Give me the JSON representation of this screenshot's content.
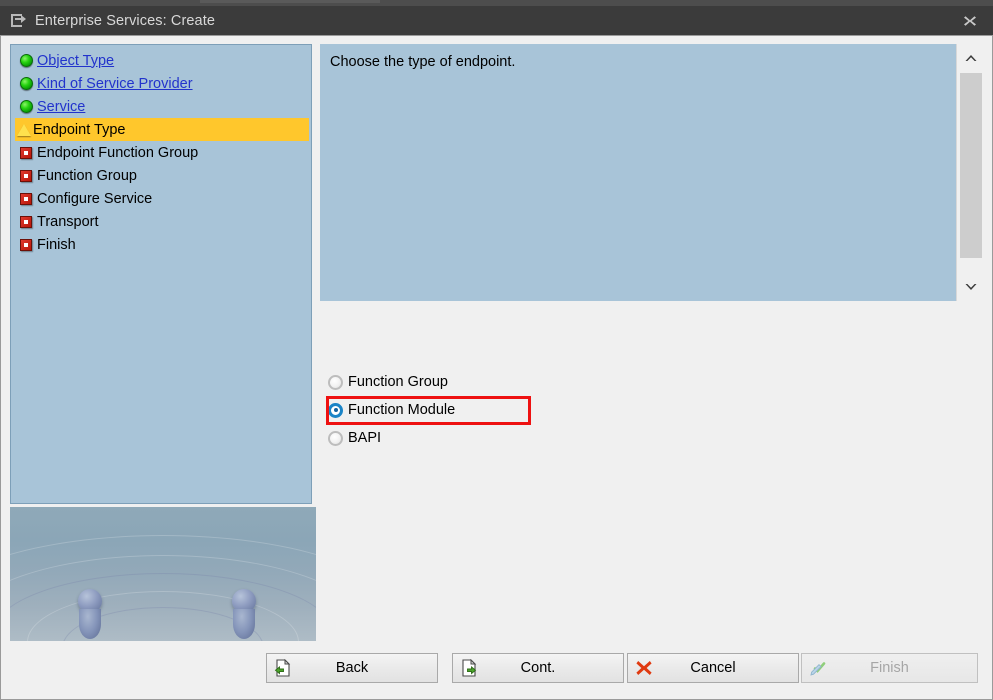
{
  "window": {
    "title": "Enterprise Services: Create",
    "title_icon": "export-window-icon",
    "close_label": "close-icon"
  },
  "roadmap": {
    "steps": [
      {
        "label": "Object Type",
        "status": "done",
        "icon": "green-circle-icon",
        "is_link": true
      },
      {
        "label": "Kind of Service Provider",
        "status": "done",
        "icon": "green-circle-icon",
        "is_link": true
      },
      {
        "label": "Service",
        "status": "done",
        "icon": "green-circle-icon",
        "is_link": true
      },
      {
        "label": "Endpoint Type",
        "status": "current",
        "icon": "yellow-triangle-icon",
        "is_link": false
      },
      {
        "label": "Endpoint Function Group",
        "status": "pending",
        "icon": "red-square-icon",
        "is_link": false
      },
      {
        "label": "Function Group",
        "status": "pending",
        "icon": "red-square-icon",
        "is_link": false
      },
      {
        "label": "Configure Service",
        "status": "pending",
        "icon": "red-square-icon",
        "is_link": false
      },
      {
        "label": "Transport",
        "status": "pending",
        "icon": "red-square-icon",
        "is_link": false
      },
      {
        "label": "Finish",
        "status": "pending",
        "icon": "red-square-icon",
        "is_link": false
      }
    ]
  },
  "main": {
    "instruction": "Choose the type of endpoint.",
    "scrollbar": {
      "up_icon": "chevron-up-icon",
      "down_icon": "chevron-down-icon"
    },
    "endpoint_options": [
      {
        "label": "Function Group",
        "selected": false
      },
      {
        "label": "Function Module",
        "selected": true
      },
      {
        "label": "BAPI",
        "selected": false
      }
    ]
  },
  "footer": {
    "buttons": [
      {
        "label": "Back",
        "icon": "document-back-arrow-icon",
        "enabled": true
      },
      {
        "label": "Cont.",
        "icon": "document-forward-arrow-icon",
        "enabled": true
      },
      {
        "label": "Cancel",
        "icon": "red-x-icon",
        "enabled": true
      },
      {
        "label": "Finish",
        "icon": "check-pencil-icon",
        "enabled": false
      }
    ]
  },
  "colors": {
    "titlebar": "#3b3b3b",
    "panel_blue": "#a8c4d8",
    "highlight_yellow": "#ffc72c",
    "link_blue": "#2233cc",
    "annotation_red": "#ee1111",
    "radio_selected_blue": "#1a84c7"
  }
}
